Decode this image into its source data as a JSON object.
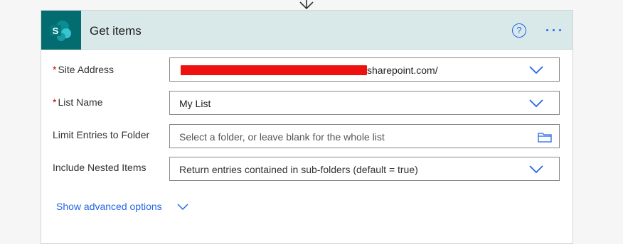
{
  "card": {
    "title": "Get items",
    "help_symbol": "?",
    "icons": {
      "app": "sharepoint-icon",
      "help": "help-icon",
      "more": "more-options-icon"
    },
    "colors": {
      "header_bg": "#d9e8e8",
      "app_tile_bg": "#036c70",
      "accent": "#2266e3",
      "required": "#c80000",
      "redaction": "#ee1111"
    }
  },
  "fields": {
    "site_address": {
      "label": "Site Address",
      "required_mark": "*",
      "value_suffix": "sharepoint.com/"
    },
    "list_name": {
      "label": "List Name",
      "required_mark": "*",
      "value": "My List"
    },
    "limit_folder": {
      "label": "Limit Entries to Folder",
      "placeholder": "Select a folder, or leave blank for the whole list"
    },
    "nested_items": {
      "label": "Include Nested Items",
      "value": "Return entries contained in sub-folders (default = true)"
    }
  },
  "advanced": {
    "label": "Show advanced options"
  }
}
